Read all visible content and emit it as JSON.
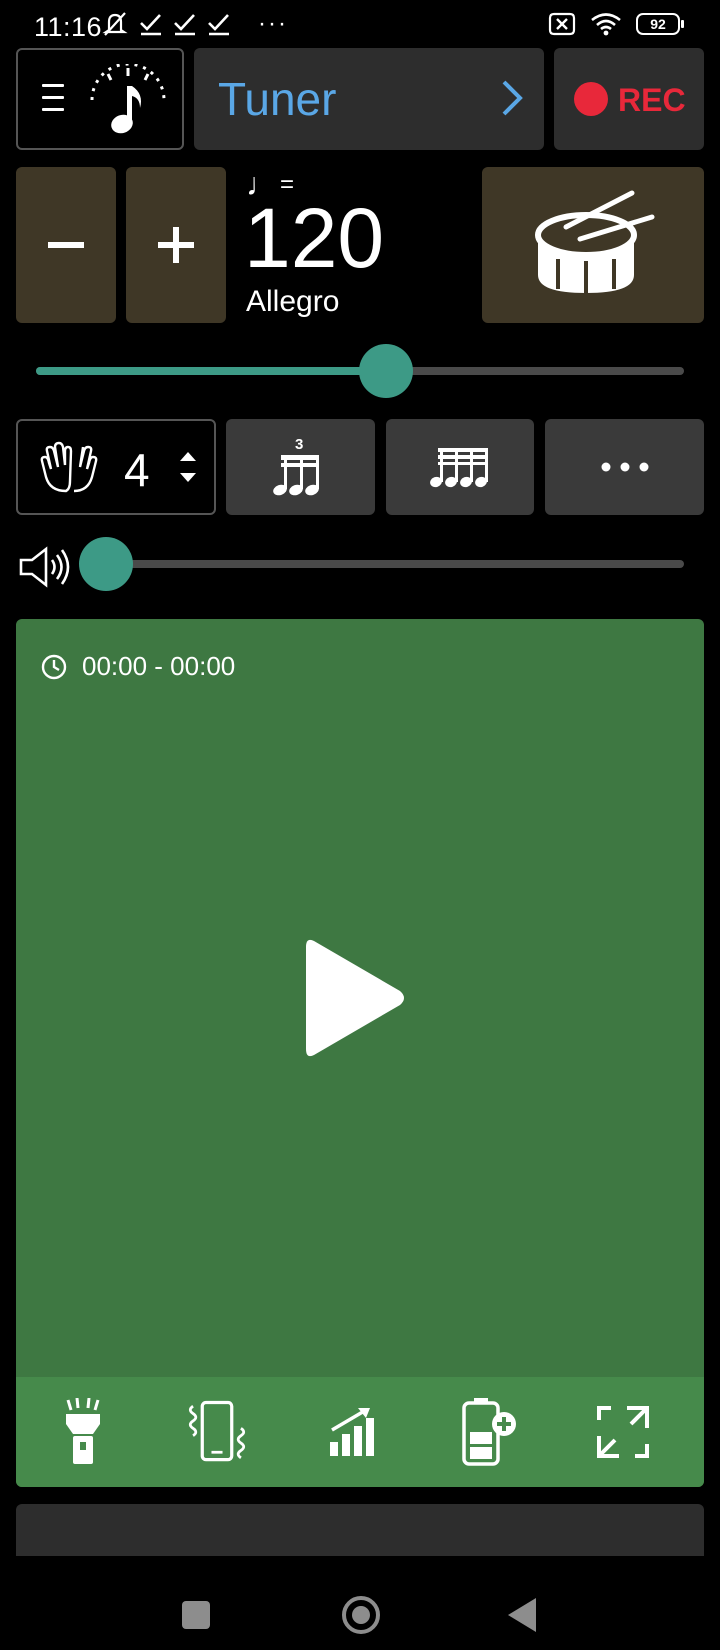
{
  "status_bar": {
    "time": "11:16",
    "more": "···",
    "battery": "92",
    "icons": [
      "muted-bell-icon",
      "check-icon",
      "check-icon",
      "check-icon",
      "sim-off-icon",
      "wifi-icon",
      "battery-icon"
    ]
  },
  "header": {
    "menu_icon": "hamburger-icon",
    "logo_icon": "metronome-note-icon",
    "tuner_label": "Tuner",
    "rec_label": "REC"
  },
  "tempo": {
    "note_symbol": "♩",
    "equals": "=",
    "bpm": "120",
    "name": "Allegro",
    "slider_fraction": 0.54
  },
  "beats": {
    "value": "4",
    "subdivision_options": [
      "triplet-icon",
      "sixteenth-notes-icon",
      "more-icon"
    ]
  },
  "volume": {
    "level_fraction": 0.0
  },
  "practice": {
    "timer": "00:00 - 00:00",
    "tools": [
      "flashlight-icon",
      "vibrate-icon",
      "tempo-increase-icon",
      "battery-saver-icon",
      "fullscreen-icon"
    ]
  },
  "colors": {
    "accent_teal": "#3d9a86",
    "panel_green": "#3e7842",
    "rec_red": "#e8283a",
    "tuner_blue": "#5aa7e6",
    "tempo_button_brown": "#3f3726"
  }
}
